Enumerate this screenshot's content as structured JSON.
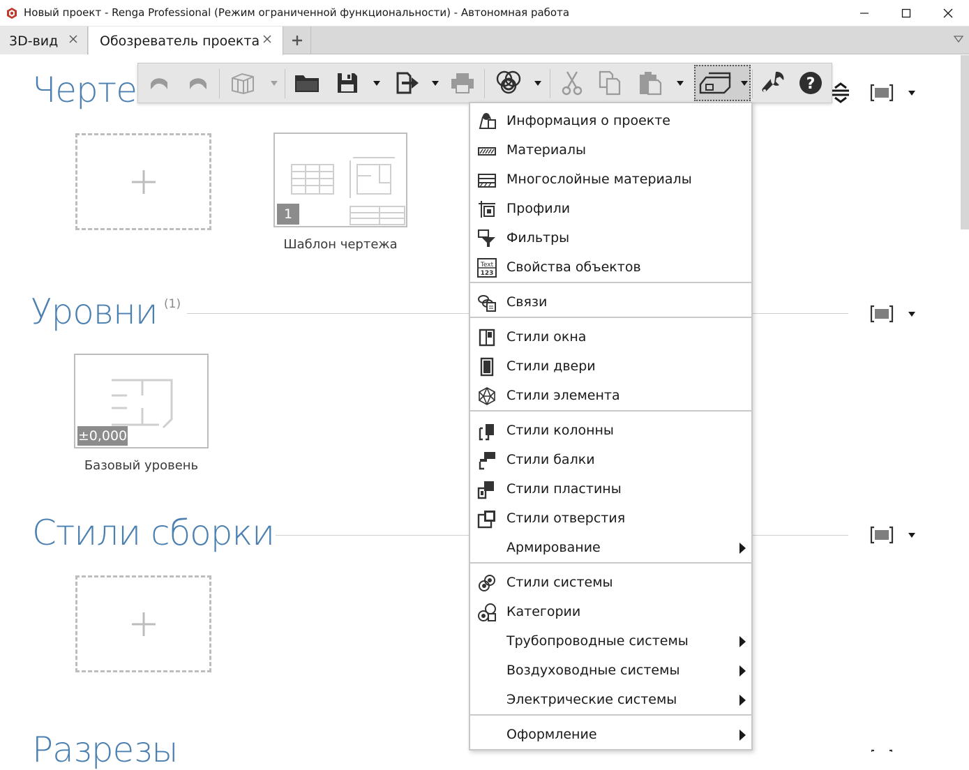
{
  "window": {
    "title": "Новый проект - Renga Professional (Режим ограниченной функциональности) - Автономная работа",
    "minimize_icon": "minimize-icon",
    "maximize_icon": "maximize-icon",
    "close_icon": "close-icon"
  },
  "tabs": [
    {
      "label": "3D-вид",
      "active": false
    },
    {
      "label": "Обозреватель проекта",
      "active": true
    }
  ],
  "tab_add_label": "+",
  "sections": {
    "drawings": {
      "title": "Чертежи",
      "template_caption": "Шаблон чертежа",
      "template_badge": "1"
    },
    "levels": {
      "title": "Уровни",
      "count": "(1)",
      "level_caption": "Базовый уровень",
      "level_badge": "±0,000"
    },
    "assembly_styles": {
      "title": "Стили сборки"
    },
    "sections_cut": {
      "title": "Разрезы"
    }
  },
  "toolbar": {
    "buttons": [
      "undo-icon",
      "redo-icon",
      "3d-view-icon",
      "open-icon",
      "save-icon",
      "export-icon",
      "print-icon",
      "sync-icon",
      "cut-icon",
      "copy-icon",
      "paste-icon",
      "project-settings-icon",
      "wrench-icon",
      "help-icon"
    ],
    "help_label": "?"
  },
  "menu": {
    "groups": [
      [
        {
          "label": "Информация о проекте",
          "icon": "project-info-icon"
        },
        {
          "label": "Материалы",
          "icon": "materials-icon"
        },
        {
          "label": "Многослойные материалы",
          "icon": "layered-materials-icon"
        },
        {
          "label": "Профили",
          "icon": "profiles-icon"
        },
        {
          "label": "Фильтры",
          "icon": "filters-icon"
        },
        {
          "label": "Свойства объектов",
          "icon": "object-properties-icon"
        }
      ],
      [
        {
          "label": "Связи",
          "icon": "links-icon"
        }
      ],
      [
        {
          "label": "Стили окна",
          "icon": "window-styles-icon"
        },
        {
          "label": "Стили двери",
          "icon": "door-styles-icon"
        },
        {
          "label": "Стили элемента",
          "icon": "element-styles-icon"
        }
      ],
      [
        {
          "label": "Стили колонны",
          "icon": "column-styles-icon"
        },
        {
          "label": "Стили балки",
          "icon": "beam-styles-icon"
        },
        {
          "label": "Стили пластины",
          "icon": "plate-styles-icon"
        },
        {
          "label": "Стили отверстия",
          "icon": "opening-styles-icon"
        },
        {
          "label": "Армирование",
          "icon": "",
          "submenu": true
        }
      ],
      [
        {
          "label": "Стили системы",
          "icon": "system-styles-icon"
        },
        {
          "label": "Категории",
          "icon": "categories-icon"
        },
        {
          "label": "Трубопроводные системы",
          "icon": "",
          "submenu": true
        },
        {
          "label": "Воздуховодные системы",
          "icon": "",
          "submenu": true
        },
        {
          "label": "Электрические системы",
          "icon": "",
          "submenu": true
        }
      ],
      [
        {
          "label": "Оформление",
          "icon": "",
          "submenu": true
        }
      ]
    ]
  },
  "colors": {
    "section_title": "#4a7fb0",
    "accent_red": "#c0392b"
  }
}
